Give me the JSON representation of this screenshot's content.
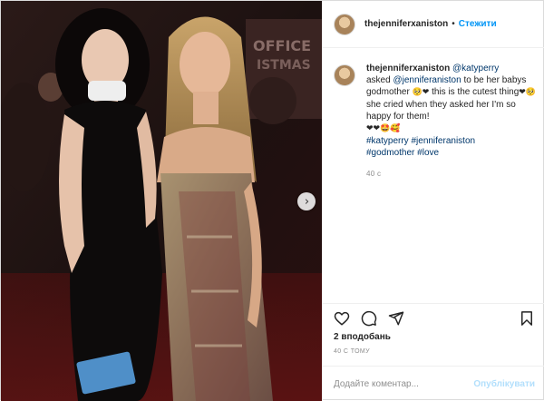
{
  "header": {
    "username": "thejenniferxaniston",
    "separator": "•",
    "follow_label": "Стежити"
  },
  "caption": {
    "username": "thejenniferxaniston",
    "mention_1": "@katyperry",
    "text_1": "asked",
    "mention_2": "@jenniferaniston",
    "text_2": "to be her babys godmother",
    "emoji_1": "🥺❤",
    "text_3": "this is the cutest thing",
    "emoji_2": "❤🥺",
    "text_4": "she cried when they asked her I'm so happy for them!",
    "emoji_3": "❤❤🤩🥰",
    "hashtag_1": "#katyperry",
    "hashtag_2": "#jenniferaniston",
    "hashtag_3": "#godmother",
    "hashtag_4": "#love",
    "time": "40 с"
  },
  "actions": {
    "like_icon": "heart-icon",
    "comment_icon": "comment-icon",
    "share_icon": "share-icon",
    "save_icon": "bookmark-icon"
  },
  "likes_text": "2 вподобань",
  "time_ago": "40 с тому",
  "comment_input": {
    "placeholder": "Додайте коментар...",
    "publish_label": "Опублікувати"
  },
  "photo": {
    "next_icon": "chevron-right-icon",
    "next_glyph": "›"
  },
  "colors": {
    "link": "#00376b",
    "follow": "#0095f6",
    "publish_disabled": "#b2dffc",
    "muted": "#8e8e8e"
  }
}
